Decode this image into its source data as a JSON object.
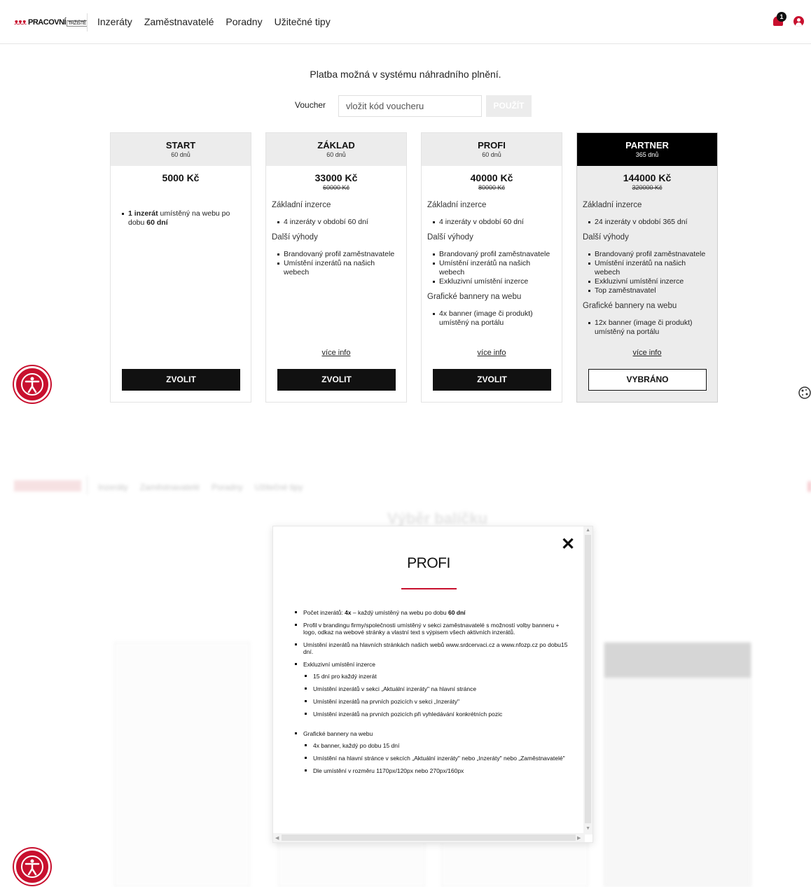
{
  "header": {
    "logo_text": "PRACOVNÍ",
    "logo_sub": "TRŽIŠTĚ",
    "nav": [
      "Inzeráty",
      "Zaměstnavatelé",
      "Poradny",
      "Užitečné tipy"
    ],
    "notification_count": "1"
  },
  "payment_info": "Platba možná v systému náhradního plnění.",
  "voucher": {
    "label": "Voucher",
    "placeholder": "vložit kód voucheru",
    "apply_label": "POUŽÍT"
  },
  "packages": [
    {
      "name": "START",
      "days": "60 dnů",
      "price": "5000 Kč",
      "old_price": "",
      "items_intro": [
        {
          "bold1": "1 inzerát",
          "text1": " umístěný na webu po dobu ",
          "bold2": "60 dní"
        }
      ],
      "button": "ZVOLIT"
    },
    {
      "name": "ZÁKLAD",
      "days": "60 dnů",
      "price": "33000 Kč",
      "old_price": "60000 Kč",
      "section1": "Základní inzerce",
      "list1": [
        "4 inzeráty v období 60 dní"
      ],
      "section2": "Další výhody",
      "list2": [
        "Brandovaný profil zaměstnavatele",
        "Umístění inzerátů na našich webech"
      ],
      "more": "více info",
      "button": "ZVOLIT"
    },
    {
      "name": "PROFI",
      "days": "60 dnů",
      "price": "40000 Kč",
      "old_price": "80000 Kč",
      "section1": "Základní inzerce",
      "list1": [
        "4 inzeráty v období 60 dní"
      ],
      "section2": "Další výhody",
      "list2": [
        "Brandovaný profil zaměstnavatele",
        "Umístění inzerátů na našich webech",
        "Exkluzivní umístění inzerce"
      ],
      "section3": "Grafické bannery na webu",
      "list3": [
        "4x banner (image či produkt) umístěný na portálu"
      ],
      "more": "více info",
      "button": "ZVOLIT"
    },
    {
      "name": "PARTNER",
      "days": "365 dnů",
      "price": "144000 Kč",
      "old_price": "320000 Kč",
      "section1": "Základní inzerce",
      "list1": [
        "24 inzeráty v období 365 dní"
      ],
      "section2": "Další výhody",
      "list2": [
        "Brandovaný profil zaměstnavatele",
        "Umístění inzerátů na našich webech",
        "Exkluzivní umístění inzerce",
        "Top zaměstnavatel"
      ],
      "section3": "Grafické bannery na webu",
      "list3": [
        "12x banner (image či produkt) umístěný na portálu"
      ],
      "more": "více info",
      "button": "VYBRÁNO"
    }
  ],
  "modal": {
    "title": "PROFI",
    "items": {
      "i1_a": "Počet inzerátů: ",
      "i1_b": "4x",
      "i1_c": " – každý umístěný na webu po dobu ",
      "i1_d": "60 dní",
      "i2": "Profil v brandingu firmy/společnosti umístěný v sekci zaměstnavatelé s možností volby banneru + logo, odkaz na webové stránky a vlastní text s výpisem všech aktivních inzerátů.",
      "i3": "Umístění inzerátů na hlavních stránkách našich webů www.srdcervaci.cz a www.nfozp.cz po dobu15 dní.",
      "i4": "Exkluzivní umístění inzerce",
      "i4_sub": [
        "15 dní pro každý inzerát",
        "Umístění inzerátů v sekci „Aktuální inzeráty\" na hlavní stránce",
        "Umístění inzerátů na prvních pozicích v sekci „Inzeráty\"",
        "Umístění inzerátů na prvních pozicích při vyhledávání konkrétních pozic"
      ],
      "i5": "Grafické bannery na webu",
      "i5_sub": [
        "4x banner, každý po dobu 15 dní",
        "Umístění na hlavní stránce v sekcích „Aktuální inzeráty\" nebo „Inzeráty\" nebo „Zaměstnavatelé\"",
        "Dle umístění v rozměru 1170px/120px nebo 270px/160px"
      ]
    }
  },
  "ghost": {
    "title": "Výběr balíčku"
  },
  "icons": [
    "bell-icon",
    "user-icon",
    "accessibility-icon",
    "cookie-icon",
    "close-icon"
  ],
  "colors": {
    "accent": "#c8102e",
    "dark": "#111111",
    "header_bg": "#ececec"
  }
}
